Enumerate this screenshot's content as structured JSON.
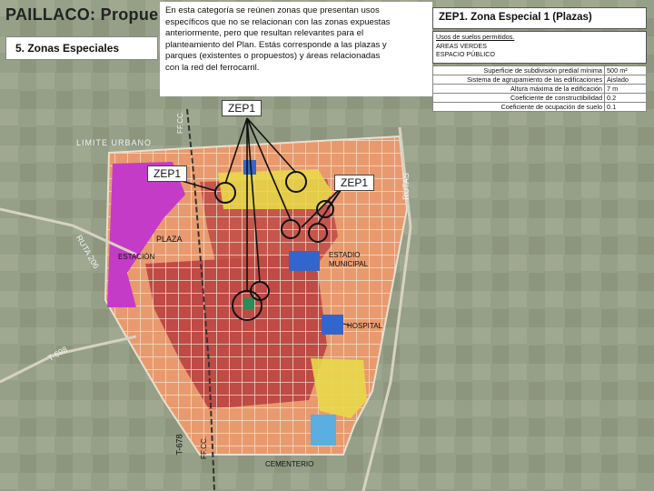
{
  "header": {
    "title": "PAILLACO: Propue",
    "section": "5. Zonas Especiales"
  },
  "description": {
    "lines": [
      "En esta categoría se reúnen zonas que presentan usos",
      "específicos que no se relacionan con las zonas expuestas",
      "anteriormente, pero que resultan relevantes para el",
      "planteamiento del Plan. Estás corresponde a las plazas y",
      "parques (existentes o propuestos) y áreas relacionadas",
      "con la red del ferrocarril."
    ]
  },
  "zone_panel": {
    "heading": "ZEP1. Zona Especial 1 (Plazas)",
    "uses_title": "Usos de suelos permitidos.",
    "uses": [
      "AREAS VERDES",
      "ESPACIO PÚBLICO"
    ],
    "parameters": [
      {
        "label": "Superficie de subdivisión predial mínima",
        "value": "500 m²"
      },
      {
        "label": "Sistema de agrupamiento de las edificaciones",
        "value": "Aislado"
      },
      {
        "label": "Altura máxima de la edificación",
        "value": "7 m"
      },
      {
        "label": "Coeficiente de constructibilidad",
        "value": "0.2"
      },
      {
        "label": "Coeficiente de ocupación de suelo",
        "value": "0.1"
      }
    ]
  },
  "map_labels": {
    "zep1_top": "ZEP1",
    "zep1_left": "ZEP1",
    "zep1_right": "ZEP1",
    "limite_urbano": "LIMITE URBANO",
    "plaza": "PLAZA",
    "estacion": "ESTACIÓN",
    "estadio": "ESTADIO",
    "municipal": "MUNICIPAL",
    "hospital": "HOSPITAL",
    "cementerio": "CEMENTERIO",
    "ruta_206": "RUTA 206",
    "rutas": "RUTAS",
    "t_678": "T-678",
    "ff_cc_bottom": "FF.CC.",
    "ff_cc_top": "FF.CC.",
    "t_698": "T-698"
  },
  "colors": {
    "zone_commercial": "#c0504d",
    "zone_residential": "#f4a582",
    "zone_magenta": "#cc33cc",
    "zone_yellow": "#f5e642",
    "zone_blue": "#3366cc",
    "zone_green_highlight": "#2e8b57",
    "callout_line": "#222222"
  }
}
